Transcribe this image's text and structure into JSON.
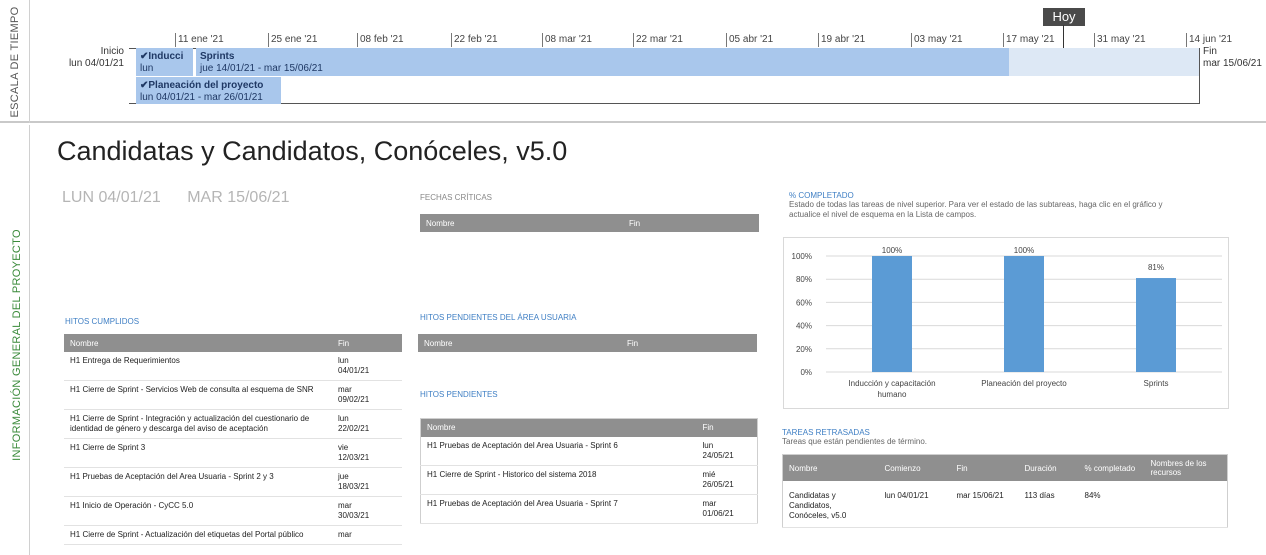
{
  "timeline": {
    "side_label": "ESCALA DE TIEMPO",
    "today_label": "Hoy",
    "start": {
      "label": "Inicio",
      "date": "lun 04/01/21"
    },
    "end": {
      "label": "Fin",
      "date": "mar 15/06/21"
    },
    "ticks": [
      "11 ene '21",
      "25 ene '21",
      "08 feb '21",
      "22 feb '21",
      "08 mar '21",
      "22 mar '21",
      "05 abr '21",
      "19 abr '21",
      "03 may '21",
      "17 may '21",
      "31 may '21",
      "14 jun '21"
    ],
    "bars": {
      "induccion": {
        "name": "✔Inducci",
        "date": "lun"
      },
      "sprints": {
        "name": "Sprints",
        "date": "jue 14/01/21 - mar 15/06/21"
      },
      "planeacion": {
        "name": "✔Planeación del proyecto",
        "date": "lun 04/01/21 - mar 26/01/21"
      }
    }
  },
  "overview": {
    "side_label": "INFORMACIÓN GENERAL DEL PROYECTO",
    "title": "Candidatas y Candidatos, Conóceles, v5.0",
    "start_date": "LUN 04/01/21",
    "end_date": "MAR 15/06/21"
  },
  "critical_dates": {
    "label": "FECHAS CRÍTICAS",
    "columns": [
      "Nombre",
      "Fin"
    ]
  },
  "milestones_done": {
    "label": "HITOS CUMPLIDOS",
    "columns": [
      "Nombre",
      "Fin"
    ],
    "rows": [
      {
        "name": "H1 Entrega de Requerimientos",
        "end_day": "lun",
        "end_date": "04/01/21"
      },
      {
        "name": "H1 Cierre de Sprint - Servicios Web de consulta al esquema de SNR",
        "end_day": "mar",
        "end_date": "09/02/21"
      },
      {
        "name": "H1 Cierre de Sprint - Integración y actualización del cuestionario de identidad de género y descarga del aviso de aceptación",
        "end_day": "lun",
        "end_date": "22/02/21"
      },
      {
        "name": "H1 Cierre de Sprint 3",
        "end_day": "vie",
        "end_date": "12/03/21"
      },
      {
        "name": "H1 Pruebas de Aceptación del Area Usuaria - Sprint 2 y 3",
        "end_day": "jue",
        "end_date": "18/03/21"
      },
      {
        "name": "H1 Inicio de Operación - CyCC 5.0",
        "end_day": "mar",
        "end_date": "30/03/21"
      },
      {
        "name": "H1 Cierre de Sprint - Actualización del etiquetas del Portal público",
        "end_day": "mar",
        "end_date": ""
      }
    ]
  },
  "user_area_pending": {
    "label": "HITOS PENDIENTES DEL ÁREA USUARIA",
    "columns": [
      "Nombre",
      "Fin"
    ]
  },
  "pending": {
    "label": "HITOS PENDIENTES",
    "columns": [
      "Nombre",
      "Fin"
    ],
    "rows": [
      {
        "name": "H1 Pruebas de Aceptación del Area Usuaria - Sprint 6",
        "end_day": "lun",
        "end_date": "24/05/21"
      },
      {
        "name": "H1 Cierre de Sprint - Historico del sistema 2018",
        "end_day": "mié",
        "end_date": "26/05/21"
      },
      {
        "name": "H1 Pruebas de Aceptación del Area Usuaria - Sprint 7",
        "end_day": "mar",
        "end_date": "01/06/21"
      }
    ]
  },
  "percent_complete": {
    "label": "% COMPLETADO",
    "description": "Estado de todas las tareas de nivel superior. Para ver el estado de las subtareas, haga clic en el gráfico y actualice el nivel de esquema en la Lista de campos."
  },
  "chart_data": {
    "type": "bar",
    "categories": [
      "Inducción y capacitación humano",
      "Planeación del proyecto",
      "Sprints"
    ],
    "category_lines": [
      [
        "Inducción y capacitación",
        "humano"
      ],
      [
        "Planeación del proyecto"
      ],
      [
        "Sprints"
      ]
    ],
    "values": [
      100,
      100,
      81
    ],
    "value_labels": [
      "100%",
      "100%",
      "81%"
    ],
    "y_ticks": [
      "0%",
      "20%",
      "40%",
      "60%",
      "80%",
      "100%"
    ],
    "ylim": [
      0,
      100
    ],
    "bar_color": "#5b9bd5",
    "grid": true
  },
  "late_tasks": {
    "label": "TAREAS RETRASADAS",
    "description": "Tareas que están pendientes de término.",
    "columns": [
      "Nombre",
      "Comienzo",
      "Fin",
      "Duración",
      "% completado",
      "Nombres de los recursos"
    ],
    "rows": [
      {
        "name": "Candidatas y Candidatos, Conóceles, v5.0",
        "start": "lun 04/01/21",
        "end": "mar 15/06/21",
        "duration": "113 días",
        "percent": "84%",
        "resources": ""
      }
    ]
  },
  "colors": {
    "bar_done": "#a9c7ec",
    "bar_remaining": "#dde8f5",
    "section_label": "#3f7fc4",
    "side_overview": "#3a8a3a",
    "table_header": "#8f8f8f"
  }
}
